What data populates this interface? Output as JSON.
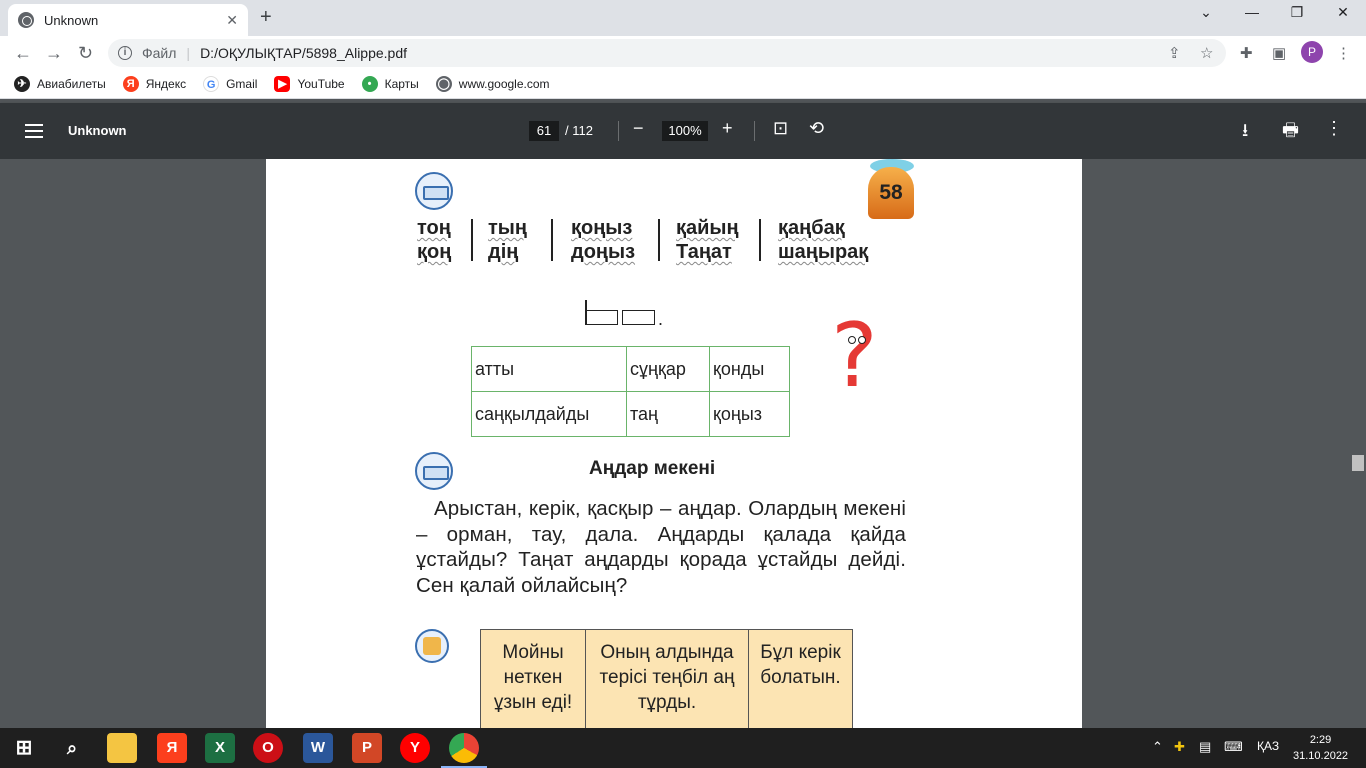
{
  "browser": {
    "tab_title": "Unknown",
    "tab_close": "✕",
    "new_tab": "+",
    "window_controls": [
      "⌄",
      "—",
      "❐",
      "✕"
    ],
    "nav": {
      "back": "←",
      "forward": "→",
      "reload": "↻"
    },
    "address": {
      "scheme_label": "Файл",
      "url": "D:/ОҚУЛЫҚТАР/5898_Alippe.pdf"
    },
    "profile_initial": "P",
    "bookmarks": [
      {
        "label": "Авиабилеты",
        "icon": "plane-icon",
        "color": "#222222"
      },
      {
        "label": "Яндекс",
        "icon": "yandex-icon",
        "color": "#fc3f1d"
      },
      {
        "label": "Gmail",
        "icon": "google-g-icon",
        "color": "#4285f4"
      },
      {
        "label": "YouTube",
        "icon": "youtube-icon",
        "color": "#ff0000"
      },
      {
        "label": "Карты",
        "icon": "maps-pin-icon",
        "color": "#34a853"
      },
      {
        "label": "www.google.com",
        "icon": "globe-icon",
        "color": "#5f6368"
      }
    ]
  },
  "pdf_toolbar": {
    "title": "Unknown",
    "current_page": "61",
    "total_pages": "/ 112",
    "zoom_minus": "−",
    "zoom": "100%",
    "zoom_plus": "+",
    "fit_icon": "⊡",
    "rotate_icon": "⟲",
    "download_icon": "⭳",
    "print_icon": "🖶",
    "more_icon": "⋮"
  },
  "page": {
    "page_number": "58",
    "word_columns": [
      [
        "тоң",
        "қоң"
      ],
      [
        "тың",
        "дің"
      ],
      [
        "қоңыз",
        "доңыз"
      ],
      [
        "қайың",
        "Таңат"
      ],
      [
        "қаңбақ",
        "шаңырақ"
      ]
    ],
    "scheme_dot": ".",
    "table1": [
      [
        "атты",
        "сұңқар",
        "қонды"
      ],
      [
        "саңқылдайды",
        "таң",
        "қоңыз"
      ]
    ],
    "question_mark": "?",
    "heading": "Аңдар мекені",
    "paragraph": "Арыстан, керік, қасқыр – аңдар. Олардың мекені – орман, тау, дала. Аңдарды қалада қайда ұстайды? Таңат аңдарды қорада ұстайды дейді. Сен қалай ойлайсың?",
    "table2": [
      "Мойны неткен ұзын еді!",
      "Оның алдында терісі теңбіл аң тұрды.",
      "Бұл керік болатын."
    ]
  },
  "taskbar": {
    "apps": [
      {
        "name": "file-explorer",
        "label": "",
        "color": "#f4c542"
      },
      {
        "name": "yandex-browser",
        "label": "Я",
        "color": "#fc3f1d"
      },
      {
        "name": "excel",
        "label": "X",
        "color": "#1d6f42"
      },
      {
        "name": "opera",
        "label": "O",
        "color": "#cc0f16"
      },
      {
        "name": "word",
        "label": "W",
        "color": "#2b579a"
      },
      {
        "name": "powerpoint",
        "label": "P",
        "color": "#d24726"
      },
      {
        "name": "yandex",
        "label": "Y",
        "color": "#ff0000"
      },
      {
        "name": "chrome",
        "label": "",
        "color": "#4285f4"
      }
    ],
    "language": "ҚАЗ",
    "time": "2:29",
    "date": "31.10.2022"
  }
}
